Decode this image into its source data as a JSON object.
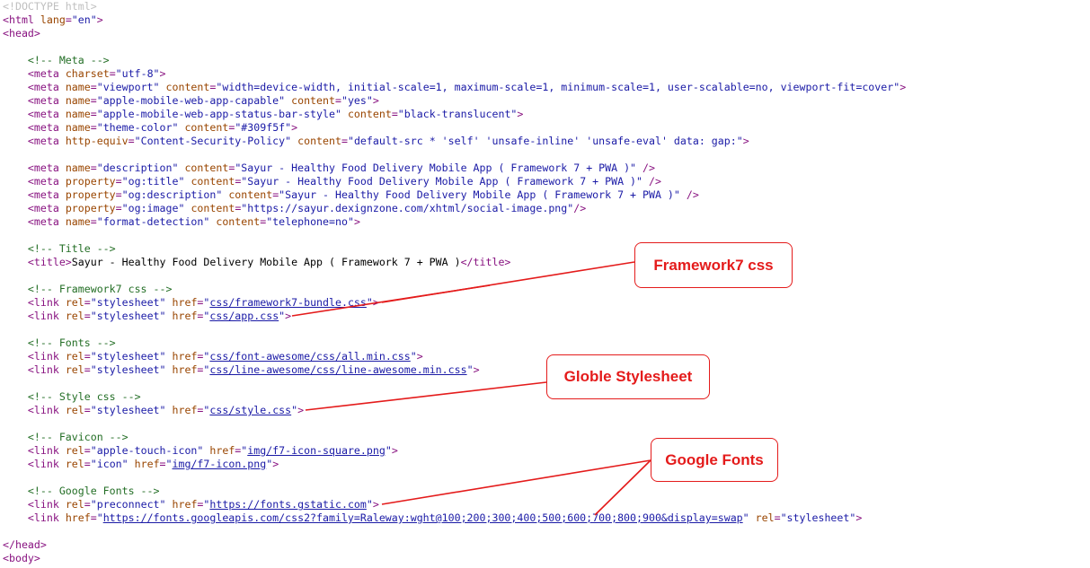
{
  "code_lines": [
    [
      [
        "doctype",
        "<!DOCTYPE html>"
      ]
    ],
    [
      [
        "tag",
        "<html "
      ],
      [
        "attr",
        "lang"
      ],
      [
        "tag",
        "="
      ],
      [
        "val",
        "\"en\""
      ],
      [
        "tag",
        ">"
      ]
    ],
    [
      [
        "tag",
        "<head>"
      ]
    ],
    [],
    [
      [
        "text",
        "    "
      ],
      [
        "cmt",
        "<!-- Meta -->"
      ]
    ],
    [
      [
        "text",
        "    "
      ],
      [
        "tag",
        "<meta "
      ],
      [
        "attr",
        "charset"
      ],
      [
        "tag",
        "="
      ],
      [
        "val",
        "\"utf-8\""
      ],
      [
        "tag",
        ">"
      ]
    ],
    [
      [
        "text",
        "    "
      ],
      [
        "tag",
        "<meta "
      ],
      [
        "attr",
        "name"
      ],
      [
        "tag",
        "="
      ],
      [
        "val",
        "\"viewport\""
      ],
      [
        "text",
        " "
      ],
      [
        "attr",
        "content"
      ],
      [
        "tag",
        "="
      ],
      [
        "val",
        "\"width=device-width, initial-scale=1, maximum-scale=1, minimum-scale=1, user-scalable=no, viewport-fit=cover\""
      ],
      [
        "tag",
        ">"
      ]
    ],
    [
      [
        "text",
        "    "
      ],
      [
        "tag",
        "<meta "
      ],
      [
        "attr",
        "name"
      ],
      [
        "tag",
        "="
      ],
      [
        "val",
        "\"apple-mobile-web-app-capable\""
      ],
      [
        "text",
        " "
      ],
      [
        "attr",
        "content"
      ],
      [
        "tag",
        "="
      ],
      [
        "val",
        "\"yes\""
      ],
      [
        "tag",
        ">"
      ]
    ],
    [
      [
        "text",
        "    "
      ],
      [
        "tag",
        "<meta "
      ],
      [
        "attr",
        "name"
      ],
      [
        "tag",
        "="
      ],
      [
        "val",
        "\"apple-mobile-web-app-status-bar-style\""
      ],
      [
        "text",
        " "
      ],
      [
        "attr",
        "content"
      ],
      [
        "tag",
        "="
      ],
      [
        "val",
        "\"black-translucent\""
      ],
      [
        "tag",
        ">"
      ]
    ],
    [
      [
        "text",
        "    "
      ],
      [
        "tag",
        "<meta "
      ],
      [
        "attr",
        "name"
      ],
      [
        "tag",
        "="
      ],
      [
        "val",
        "\"theme-color\""
      ],
      [
        "text",
        " "
      ],
      [
        "attr",
        "content"
      ],
      [
        "tag",
        "="
      ],
      [
        "val",
        "\"#309f5f\""
      ],
      [
        "tag",
        ">"
      ]
    ],
    [
      [
        "text",
        "    "
      ],
      [
        "tag",
        "<meta "
      ],
      [
        "attr",
        "http-equiv"
      ],
      [
        "tag",
        "="
      ],
      [
        "val",
        "\"Content-Security-Policy\""
      ],
      [
        "text",
        " "
      ],
      [
        "attr",
        "content"
      ],
      [
        "tag",
        "="
      ],
      [
        "val",
        "\"default-src * 'self' 'unsafe-inline' 'unsafe-eval' data: gap:\""
      ],
      [
        "tag",
        ">"
      ]
    ],
    [],
    [
      [
        "text",
        "    "
      ],
      [
        "tag",
        "<meta "
      ],
      [
        "attr",
        "name"
      ],
      [
        "tag",
        "="
      ],
      [
        "val",
        "\"description\""
      ],
      [
        "text",
        " "
      ],
      [
        "attr",
        "content"
      ],
      [
        "tag",
        "="
      ],
      [
        "val",
        "\"Sayur - Healthy Food Delivery Mobile App ( Framework 7 + PWA )\""
      ],
      [
        "tag",
        " />"
      ]
    ],
    [
      [
        "text",
        "    "
      ],
      [
        "tag",
        "<meta "
      ],
      [
        "attr",
        "property"
      ],
      [
        "tag",
        "="
      ],
      [
        "val",
        "\"og:title\""
      ],
      [
        "text",
        " "
      ],
      [
        "attr",
        "content"
      ],
      [
        "tag",
        "="
      ],
      [
        "val",
        "\"Sayur - Healthy Food Delivery Mobile App ( Framework 7 + PWA )\""
      ],
      [
        "tag",
        " />"
      ]
    ],
    [
      [
        "text",
        "    "
      ],
      [
        "tag",
        "<meta "
      ],
      [
        "attr",
        "property"
      ],
      [
        "tag",
        "="
      ],
      [
        "val",
        "\"og:description\""
      ],
      [
        "text",
        " "
      ],
      [
        "attr",
        "content"
      ],
      [
        "tag",
        "="
      ],
      [
        "val",
        "\"Sayur - Healthy Food Delivery Mobile App ( Framework 7 + PWA )\""
      ],
      [
        "tag",
        " />"
      ]
    ],
    [
      [
        "text",
        "    "
      ],
      [
        "tag",
        "<meta "
      ],
      [
        "attr",
        "property"
      ],
      [
        "tag",
        "="
      ],
      [
        "val",
        "\"og:image\""
      ],
      [
        "text",
        " "
      ],
      [
        "attr",
        "content"
      ],
      [
        "tag",
        "="
      ],
      [
        "val",
        "\"https://sayur.dexignzone.com/xhtml/social-image.png\""
      ],
      [
        "tag",
        "/>"
      ]
    ],
    [
      [
        "text",
        "    "
      ],
      [
        "tag",
        "<meta "
      ],
      [
        "attr",
        "name"
      ],
      [
        "tag",
        "="
      ],
      [
        "val",
        "\"format-detection\""
      ],
      [
        "text",
        " "
      ],
      [
        "attr",
        "content"
      ],
      [
        "tag",
        "="
      ],
      [
        "val",
        "\"telephone=no\""
      ],
      [
        "tag",
        ">"
      ]
    ],
    [],
    [
      [
        "text",
        "    "
      ],
      [
        "cmt",
        "<!-- Title -->"
      ]
    ],
    [
      [
        "text",
        "    "
      ],
      [
        "tag",
        "<title>"
      ],
      [
        "text",
        "Sayur - Healthy Food Delivery Mobile App ( Framework 7 + PWA )"
      ],
      [
        "tag",
        "</title>"
      ]
    ],
    [],
    [
      [
        "text",
        "    "
      ],
      [
        "cmt",
        "<!-- Framework7 css -->"
      ]
    ],
    [
      [
        "text",
        "    "
      ],
      [
        "tag",
        "<link "
      ],
      [
        "attr",
        "rel"
      ],
      [
        "tag",
        "="
      ],
      [
        "val",
        "\"stylesheet\""
      ],
      [
        "text",
        " "
      ],
      [
        "attr",
        "href"
      ],
      [
        "tag",
        "="
      ],
      [
        "val",
        "\""
      ],
      [
        "link",
        "css/framework7-bundle.css"
      ],
      [
        "val",
        "\""
      ],
      [
        "tag",
        ">"
      ]
    ],
    [
      [
        "text",
        "    "
      ],
      [
        "tag",
        "<link "
      ],
      [
        "attr",
        "rel"
      ],
      [
        "tag",
        "="
      ],
      [
        "val",
        "\"stylesheet\""
      ],
      [
        "text",
        " "
      ],
      [
        "attr",
        "href"
      ],
      [
        "tag",
        "="
      ],
      [
        "val",
        "\""
      ],
      [
        "link",
        "css/app.css"
      ],
      [
        "val",
        "\""
      ],
      [
        "tag",
        ">"
      ]
    ],
    [],
    [
      [
        "text",
        "    "
      ],
      [
        "cmt",
        "<!-- Fonts -->"
      ]
    ],
    [
      [
        "text",
        "    "
      ],
      [
        "tag",
        "<link "
      ],
      [
        "attr",
        "rel"
      ],
      [
        "tag",
        "="
      ],
      [
        "val",
        "\"stylesheet\""
      ],
      [
        "text",
        " "
      ],
      [
        "attr",
        "href"
      ],
      [
        "tag",
        "="
      ],
      [
        "val",
        "\""
      ],
      [
        "link",
        "css/font-awesome/css/all.min.css"
      ],
      [
        "val",
        "\""
      ],
      [
        "tag",
        ">"
      ]
    ],
    [
      [
        "text",
        "    "
      ],
      [
        "tag",
        "<link "
      ],
      [
        "attr",
        "rel"
      ],
      [
        "tag",
        "="
      ],
      [
        "val",
        "\"stylesheet\""
      ],
      [
        "text",
        " "
      ],
      [
        "attr",
        "href"
      ],
      [
        "tag",
        "="
      ],
      [
        "val",
        "\""
      ],
      [
        "link",
        "css/line-awesome/css/line-awesome.min.css"
      ],
      [
        "val",
        "\""
      ],
      [
        "tag",
        ">"
      ]
    ],
    [],
    [
      [
        "text",
        "    "
      ],
      [
        "cmt",
        "<!-- Style css -->"
      ]
    ],
    [
      [
        "text",
        "    "
      ],
      [
        "tag",
        "<link "
      ],
      [
        "attr",
        "rel"
      ],
      [
        "tag",
        "="
      ],
      [
        "val",
        "\"stylesheet\""
      ],
      [
        "text",
        " "
      ],
      [
        "attr",
        "href"
      ],
      [
        "tag",
        "="
      ],
      [
        "val",
        "\""
      ],
      [
        "link",
        "css/style.css"
      ],
      [
        "val",
        "\""
      ],
      [
        "tag",
        ">"
      ]
    ],
    [],
    [
      [
        "text",
        "    "
      ],
      [
        "cmt",
        "<!-- Favicon -->"
      ]
    ],
    [
      [
        "text",
        "    "
      ],
      [
        "tag",
        "<link "
      ],
      [
        "attr",
        "rel"
      ],
      [
        "tag",
        "="
      ],
      [
        "val",
        "\"apple-touch-icon\""
      ],
      [
        "text",
        " "
      ],
      [
        "attr",
        "href"
      ],
      [
        "tag",
        "="
      ],
      [
        "val",
        "\""
      ],
      [
        "link",
        "img/f7-icon-square.png"
      ],
      [
        "val",
        "\""
      ],
      [
        "tag",
        ">"
      ]
    ],
    [
      [
        "text",
        "    "
      ],
      [
        "tag",
        "<link "
      ],
      [
        "attr",
        "rel"
      ],
      [
        "tag",
        "="
      ],
      [
        "val",
        "\"icon\""
      ],
      [
        "text",
        " "
      ],
      [
        "attr",
        "href"
      ],
      [
        "tag",
        "="
      ],
      [
        "val",
        "\""
      ],
      [
        "link",
        "img/f7-icon.png"
      ],
      [
        "val",
        "\""
      ],
      [
        "tag",
        ">"
      ]
    ],
    [],
    [
      [
        "text",
        "    "
      ],
      [
        "cmt",
        "<!-- Google Fonts -->"
      ]
    ],
    [
      [
        "text",
        "    "
      ],
      [
        "tag",
        "<link "
      ],
      [
        "attr",
        "rel"
      ],
      [
        "tag",
        "="
      ],
      [
        "val",
        "\"preconnect\""
      ],
      [
        "text",
        " "
      ],
      [
        "attr",
        "href"
      ],
      [
        "tag",
        "="
      ],
      [
        "val",
        "\""
      ],
      [
        "link",
        "https://fonts.gstatic.com"
      ],
      [
        "val",
        "\""
      ],
      [
        "tag",
        ">"
      ]
    ],
    [
      [
        "text",
        "    "
      ],
      [
        "tag",
        "<link "
      ],
      [
        "attr",
        "href"
      ],
      [
        "tag",
        "="
      ],
      [
        "val",
        "\""
      ],
      [
        "link",
        "https://fonts.googleapis.com/css2?family=Raleway:wght@100;200;300;400;500;600;700;800;900&display=swap"
      ],
      [
        "val",
        "\""
      ],
      [
        "text",
        " "
      ],
      [
        "attr",
        "rel"
      ],
      [
        "tag",
        "="
      ],
      [
        "val",
        "\"stylesheet\""
      ],
      [
        "tag",
        ">"
      ]
    ],
    [],
    [
      [
        "tag",
        "</head>"
      ]
    ],
    [
      [
        "tag",
        "<body>"
      ]
    ]
  ],
  "callouts": {
    "framework7": "Framework7 css",
    "globle": "Globle Stylesheet",
    "google_fonts": "Google Fonts"
  },
  "colors": {
    "tag": "#881280",
    "attribute": "#994500",
    "value": "#1a1aa6",
    "comment": "#236e25",
    "callout": "#e41b1b"
  }
}
